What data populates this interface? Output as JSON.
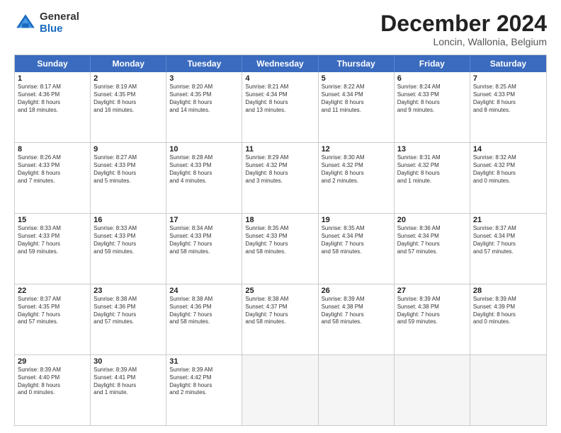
{
  "header": {
    "logo_general": "General",
    "logo_blue": "Blue",
    "month_title": "December 2024",
    "location": "Loncin, Wallonia, Belgium"
  },
  "days_of_week": [
    "Sunday",
    "Monday",
    "Tuesday",
    "Wednesday",
    "Thursday",
    "Friday",
    "Saturday"
  ],
  "weeks": [
    [
      {
        "day": "1",
        "lines": [
          "Sunrise: 8:17 AM",
          "Sunset: 4:36 PM",
          "Daylight: 8 hours",
          "and 18 minutes."
        ]
      },
      {
        "day": "2",
        "lines": [
          "Sunrise: 8:19 AM",
          "Sunset: 4:35 PM",
          "Daylight: 8 hours",
          "and 16 minutes."
        ]
      },
      {
        "day": "3",
        "lines": [
          "Sunrise: 8:20 AM",
          "Sunset: 4:35 PM",
          "Daylight: 8 hours",
          "and 14 minutes."
        ]
      },
      {
        "day": "4",
        "lines": [
          "Sunrise: 8:21 AM",
          "Sunset: 4:34 PM",
          "Daylight: 8 hours",
          "and 13 minutes."
        ]
      },
      {
        "day": "5",
        "lines": [
          "Sunrise: 8:22 AM",
          "Sunset: 4:34 PM",
          "Daylight: 8 hours",
          "and 11 minutes."
        ]
      },
      {
        "day": "6",
        "lines": [
          "Sunrise: 8:24 AM",
          "Sunset: 4:33 PM",
          "Daylight: 8 hours",
          "and 9 minutes."
        ]
      },
      {
        "day": "7",
        "lines": [
          "Sunrise: 8:25 AM",
          "Sunset: 4:33 PM",
          "Daylight: 8 hours",
          "and 8 minutes."
        ]
      }
    ],
    [
      {
        "day": "8",
        "lines": [
          "Sunrise: 8:26 AM",
          "Sunset: 4:33 PM",
          "Daylight: 8 hours",
          "and 7 minutes."
        ]
      },
      {
        "day": "9",
        "lines": [
          "Sunrise: 8:27 AM",
          "Sunset: 4:33 PM",
          "Daylight: 8 hours",
          "and 5 minutes."
        ]
      },
      {
        "day": "10",
        "lines": [
          "Sunrise: 8:28 AM",
          "Sunset: 4:33 PM",
          "Daylight: 8 hours",
          "and 4 minutes."
        ]
      },
      {
        "day": "11",
        "lines": [
          "Sunrise: 8:29 AM",
          "Sunset: 4:32 PM",
          "Daylight: 8 hours",
          "and 3 minutes."
        ]
      },
      {
        "day": "12",
        "lines": [
          "Sunrise: 8:30 AM",
          "Sunset: 4:32 PM",
          "Daylight: 8 hours",
          "and 2 minutes."
        ]
      },
      {
        "day": "13",
        "lines": [
          "Sunrise: 8:31 AM",
          "Sunset: 4:32 PM",
          "Daylight: 8 hours",
          "and 1 minute."
        ]
      },
      {
        "day": "14",
        "lines": [
          "Sunrise: 8:32 AM",
          "Sunset: 4:32 PM",
          "Daylight: 8 hours",
          "and 0 minutes."
        ]
      }
    ],
    [
      {
        "day": "15",
        "lines": [
          "Sunrise: 8:33 AM",
          "Sunset: 4:33 PM",
          "Daylight: 7 hours",
          "and 59 minutes."
        ]
      },
      {
        "day": "16",
        "lines": [
          "Sunrise: 8:33 AM",
          "Sunset: 4:33 PM",
          "Daylight: 7 hours",
          "and 59 minutes."
        ]
      },
      {
        "day": "17",
        "lines": [
          "Sunrise: 8:34 AM",
          "Sunset: 4:33 PM",
          "Daylight: 7 hours",
          "and 58 minutes."
        ]
      },
      {
        "day": "18",
        "lines": [
          "Sunrise: 8:35 AM",
          "Sunset: 4:33 PM",
          "Daylight: 7 hours",
          "and 58 minutes."
        ]
      },
      {
        "day": "19",
        "lines": [
          "Sunrise: 8:35 AM",
          "Sunset: 4:34 PM",
          "Daylight: 7 hours",
          "and 58 minutes."
        ]
      },
      {
        "day": "20",
        "lines": [
          "Sunrise: 8:36 AM",
          "Sunset: 4:34 PM",
          "Daylight: 7 hours",
          "and 57 minutes."
        ]
      },
      {
        "day": "21",
        "lines": [
          "Sunrise: 8:37 AM",
          "Sunset: 4:34 PM",
          "Daylight: 7 hours",
          "and 57 minutes."
        ]
      }
    ],
    [
      {
        "day": "22",
        "lines": [
          "Sunrise: 8:37 AM",
          "Sunset: 4:35 PM",
          "Daylight: 7 hours",
          "and 57 minutes."
        ]
      },
      {
        "day": "23",
        "lines": [
          "Sunrise: 8:38 AM",
          "Sunset: 4:36 PM",
          "Daylight: 7 hours",
          "and 57 minutes."
        ]
      },
      {
        "day": "24",
        "lines": [
          "Sunrise: 8:38 AM",
          "Sunset: 4:36 PM",
          "Daylight: 7 hours",
          "and 58 minutes."
        ]
      },
      {
        "day": "25",
        "lines": [
          "Sunrise: 8:38 AM",
          "Sunset: 4:37 PM",
          "Daylight: 7 hours",
          "and 58 minutes."
        ]
      },
      {
        "day": "26",
        "lines": [
          "Sunrise: 8:39 AM",
          "Sunset: 4:38 PM",
          "Daylight: 7 hours",
          "and 58 minutes."
        ]
      },
      {
        "day": "27",
        "lines": [
          "Sunrise: 8:39 AM",
          "Sunset: 4:38 PM",
          "Daylight: 7 hours",
          "and 59 minutes."
        ]
      },
      {
        "day": "28",
        "lines": [
          "Sunrise: 8:39 AM",
          "Sunset: 4:39 PM",
          "Daylight: 8 hours",
          "and 0 minutes."
        ]
      }
    ],
    [
      {
        "day": "29",
        "lines": [
          "Sunrise: 8:39 AM",
          "Sunset: 4:40 PM",
          "Daylight: 8 hours",
          "and 0 minutes."
        ]
      },
      {
        "day": "30",
        "lines": [
          "Sunrise: 8:39 AM",
          "Sunset: 4:41 PM",
          "Daylight: 8 hours",
          "and 1 minute."
        ]
      },
      {
        "day": "31",
        "lines": [
          "Sunrise: 8:39 AM",
          "Sunset: 4:42 PM",
          "Daylight: 8 hours",
          "and 2 minutes."
        ]
      },
      null,
      null,
      null,
      null
    ]
  ]
}
